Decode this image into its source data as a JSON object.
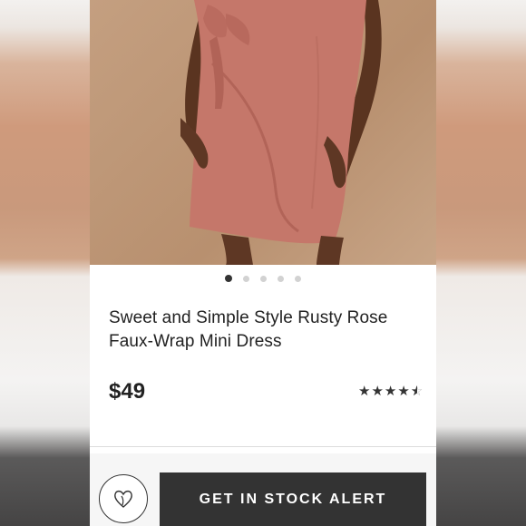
{
  "product": {
    "title_line1": "Sweet and Simple Style Rusty Rose",
    "title_line2": "Faux-Wrap Mini Dress",
    "price": "$49",
    "rating": 4.5,
    "rating_max": 5
  },
  "carousel": {
    "total": 5,
    "active_index": 0
  },
  "actions": {
    "stock_alert_label": "GET IN STOCK ALERT"
  },
  "colors": {
    "dress": "#c5776a",
    "button_dark": "#333333"
  },
  "icons": {
    "wishlist": "heart-icon",
    "rating": "star-icon"
  }
}
